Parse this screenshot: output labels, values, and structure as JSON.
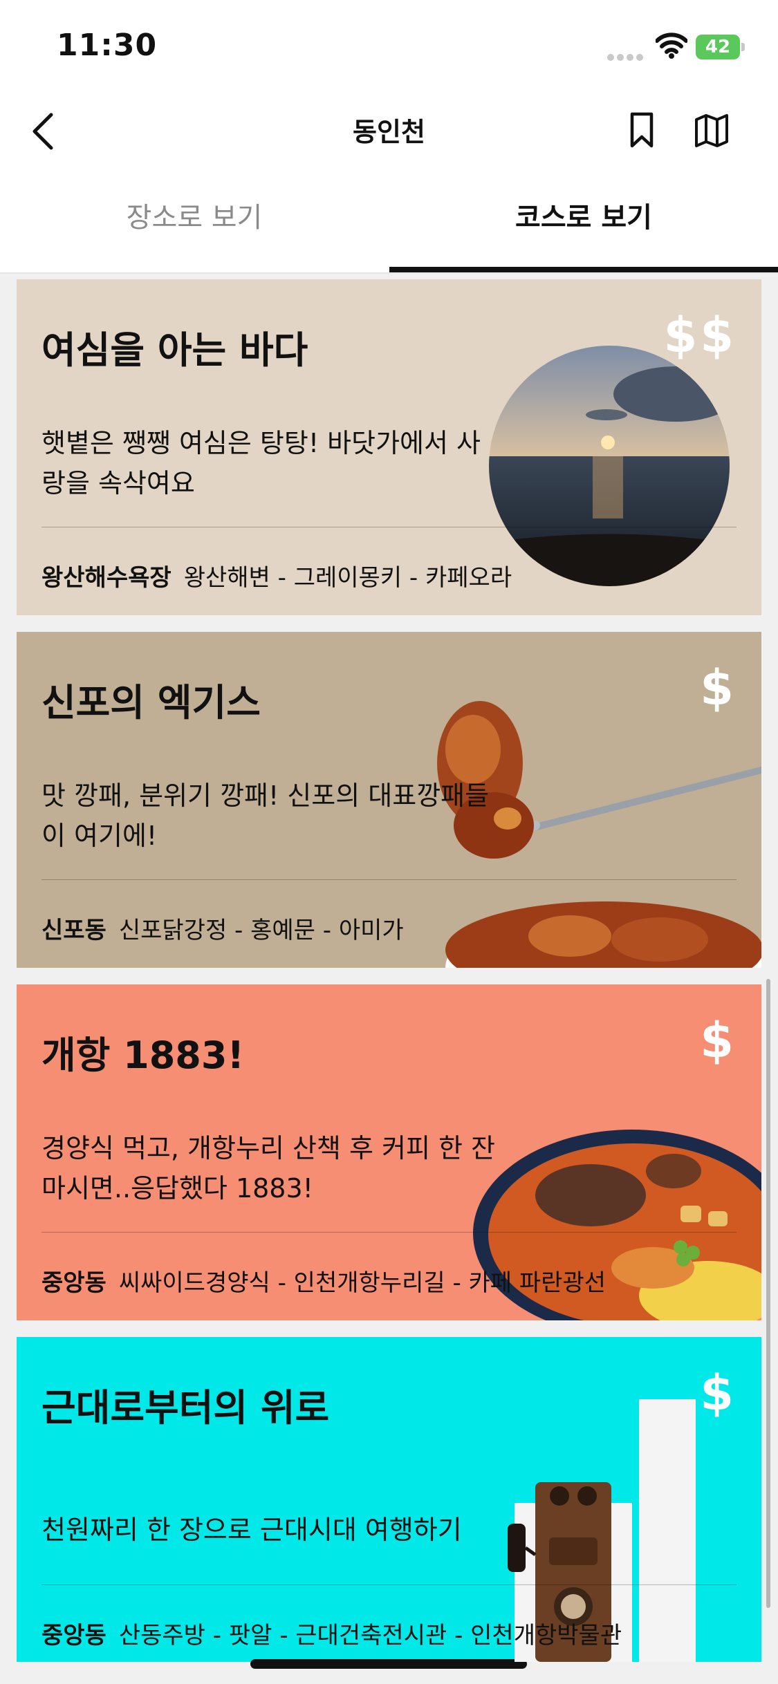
{
  "status_bar": {
    "time": "11:30",
    "battery": "42"
  },
  "header": {
    "title": "동인천"
  },
  "tabs": [
    {
      "label": "장소로 보기",
      "selected": false
    },
    {
      "label": "코스로 보기",
      "selected": true
    }
  ],
  "courses": [
    {
      "title": "여심을 아는 바다",
      "description": "햇볕은 쨍쨍 여심은 탕탕! 바닷가에서 사랑을 속삭여요",
      "area": "왕산해수욕장",
      "route": "왕산해변 - 그레이몽키 - 카페오라",
      "price": "$$",
      "color": "#e2d5c5"
    },
    {
      "title": "신포의 엑기스",
      "description": "맛 깡패, 분위기 깡패! 신포의 대표깡패들이 여기에!",
      "area": "신포동",
      "route": "신포닭강정 - 홍예문 - 아미가",
      "price": "$",
      "color": "#c0af95"
    },
    {
      "title": "개항 1883!",
      "description": "경양식 먹고, 개항누리 산책 후 커피 한 잔 마시면..응답했다 1883!",
      "area": "중앙동",
      "route": "씨싸이드경양식 - 인천개항누리길 - 카페 파란광선",
      "price": "$",
      "color": "#f68e74"
    },
    {
      "title": "근대로부터의 위로",
      "description": "천원짜리 한 장으로 근대시대 여행하기",
      "area": "중앙동",
      "route": "산동주방 - 팟알 - 근대건축전시관 - 인천개항박물관",
      "price": "$",
      "color": "#00e8e8"
    }
  ]
}
